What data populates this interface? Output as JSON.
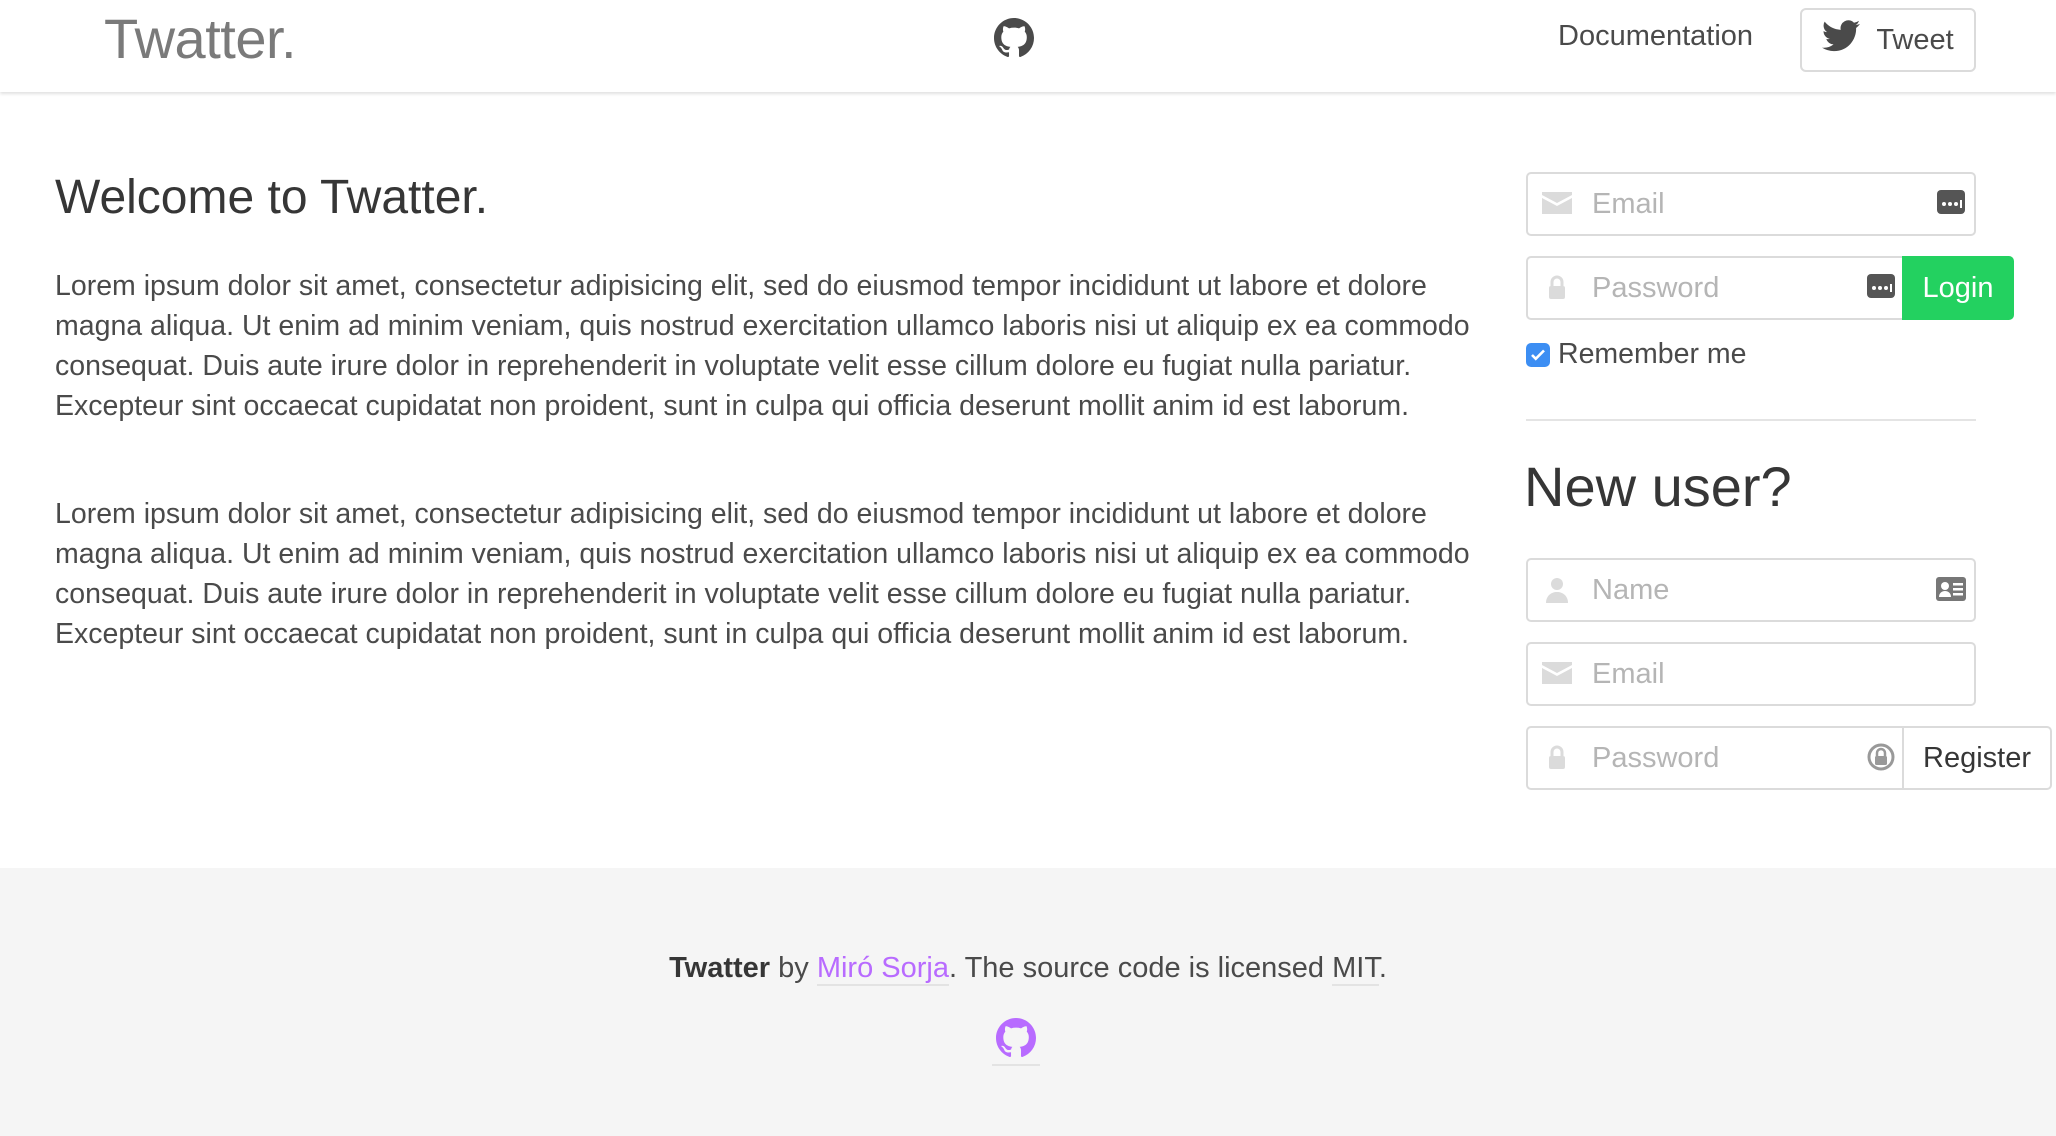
{
  "nav": {
    "brand": "Twatter.",
    "documentation": "Documentation",
    "tweet_label": "Tweet"
  },
  "main": {
    "title": "Welcome to Twatter.",
    "paragraphs": [
      "Lorem ipsum dolor sit amet, consectetur adipisicing elit, sed do eiusmod tempor incididunt ut labore et dolore magna aliqua. Ut enim ad minim veniam, quis nostrud exercitation ullamco laboris nisi ut aliquip ex ea commodo consequat. Duis aute irure dolor in reprehenderit in voluptate velit esse cillum dolore eu fugiat nulla pariatur. Excepteur sint occaecat cupidatat non proident, sunt in culpa qui officia deserunt mollit anim id est laborum.",
      "Lorem ipsum dolor sit amet, consectetur adipisicing elit, sed do eiusmod tempor incididunt ut labore et dolore magna aliqua. Ut enim ad minim veniam, quis nostrud exercitation ullamco laboris nisi ut aliquip ex ea commodo consequat. Duis aute irure dolor in reprehenderit in voluptate velit esse cillum dolore eu fugiat nulla pariatur. Excepteur sint occaecat cupidatat non proident, sunt in culpa qui officia deserunt mollit anim id est laborum."
    ]
  },
  "login": {
    "email_placeholder": "Email",
    "password_placeholder": "Password",
    "login_label": "Login",
    "remember_label": "Remember me",
    "remember_checked": true
  },
  "register": {
    "title": "New user?",
    "name_placeholder": "Name",
    "email_placeholder": "Email",
    "password_placeholder": "Password",
    "register_label": "Register"
  },
  "footer": {
    "app_name": "Twatter",
    "by": " by ",
    "author": "Miró Sorja",
    "license_text": ". The source code is licensed ",
    "license": "MIT",
    "end": "."
  },
  "colors": {
    "accent": "#23d160",
    "link": "#b86bff",
    "checkbox": "#3c8ef3"
  }
}
